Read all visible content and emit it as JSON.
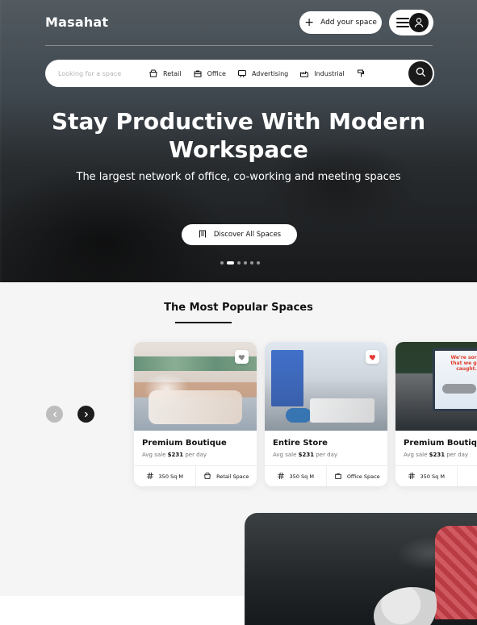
{
  "header": {
    "brand": "Masahat",
    "add_space_label": "Add your space"
  },
  "search": {
    "placeholder": "Looking for a space",
    "categories": [
      "Retail",
      "Office",
      "Advertising",
      "Industrial"
    ]
  },
  "hero": {
    "title": "Stay Productive With Modern Workspace",
    "subtitle": "The largest network of office, co-working and meeting spaces",
    "cta_label": "Discover All Spaces",
    "carousel": {
      "current": 2,
      "total": 6
    }
  },
  "popular": {
    "title": "The Most Popular Spaces",
    "cards": [
      {
        "name": "Premium Boutique",
        "price_prefix": "Avg sale ",
        "price_value": "$231",
        "price_suffix": " per day",
        "size": "350 Sq M",
        "type": "Retail Space"
      },
      {
        "name": "Entire Store",
        "price_prefix": "Avg sale ",
        "price_value": "$231",
        "price_suffix": " per day",
        "size": "350 Sq M",
        "type": "Office Space"
      },
      {
        "name": "Premium Boutique",
        "price_prefix": "Avg sale ",
        "price_value": "$231",
        "price_suffix": " per day",
        "size": "350 Sq M",
        "type": "",
        "image_text": "We're sorry that we got caught."
      }
    ]
  }
}
